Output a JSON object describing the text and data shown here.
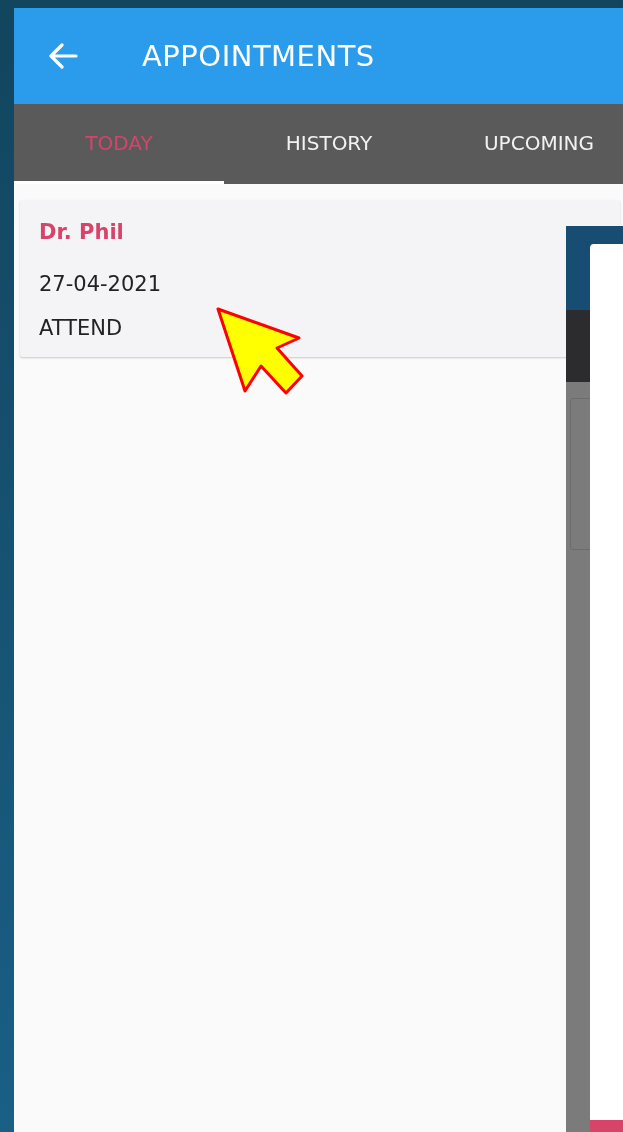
{
  "app_bar": {
    "title": "APPOINTMENTS"
  },
  "tabs": [
    {
      "label": "TODAY",
      "selected": true
    },
    {
      "label": "HISTORY",
      "selected": false
    },
    {
      "label": "UPCOMING",
      "selected": false
    }
  ],
  "appointments": [
    {
      "doctor": "Dr. Phil",
      "date": "27-04-2021",
      "status": "ATTEND"
    }
  ]
}
